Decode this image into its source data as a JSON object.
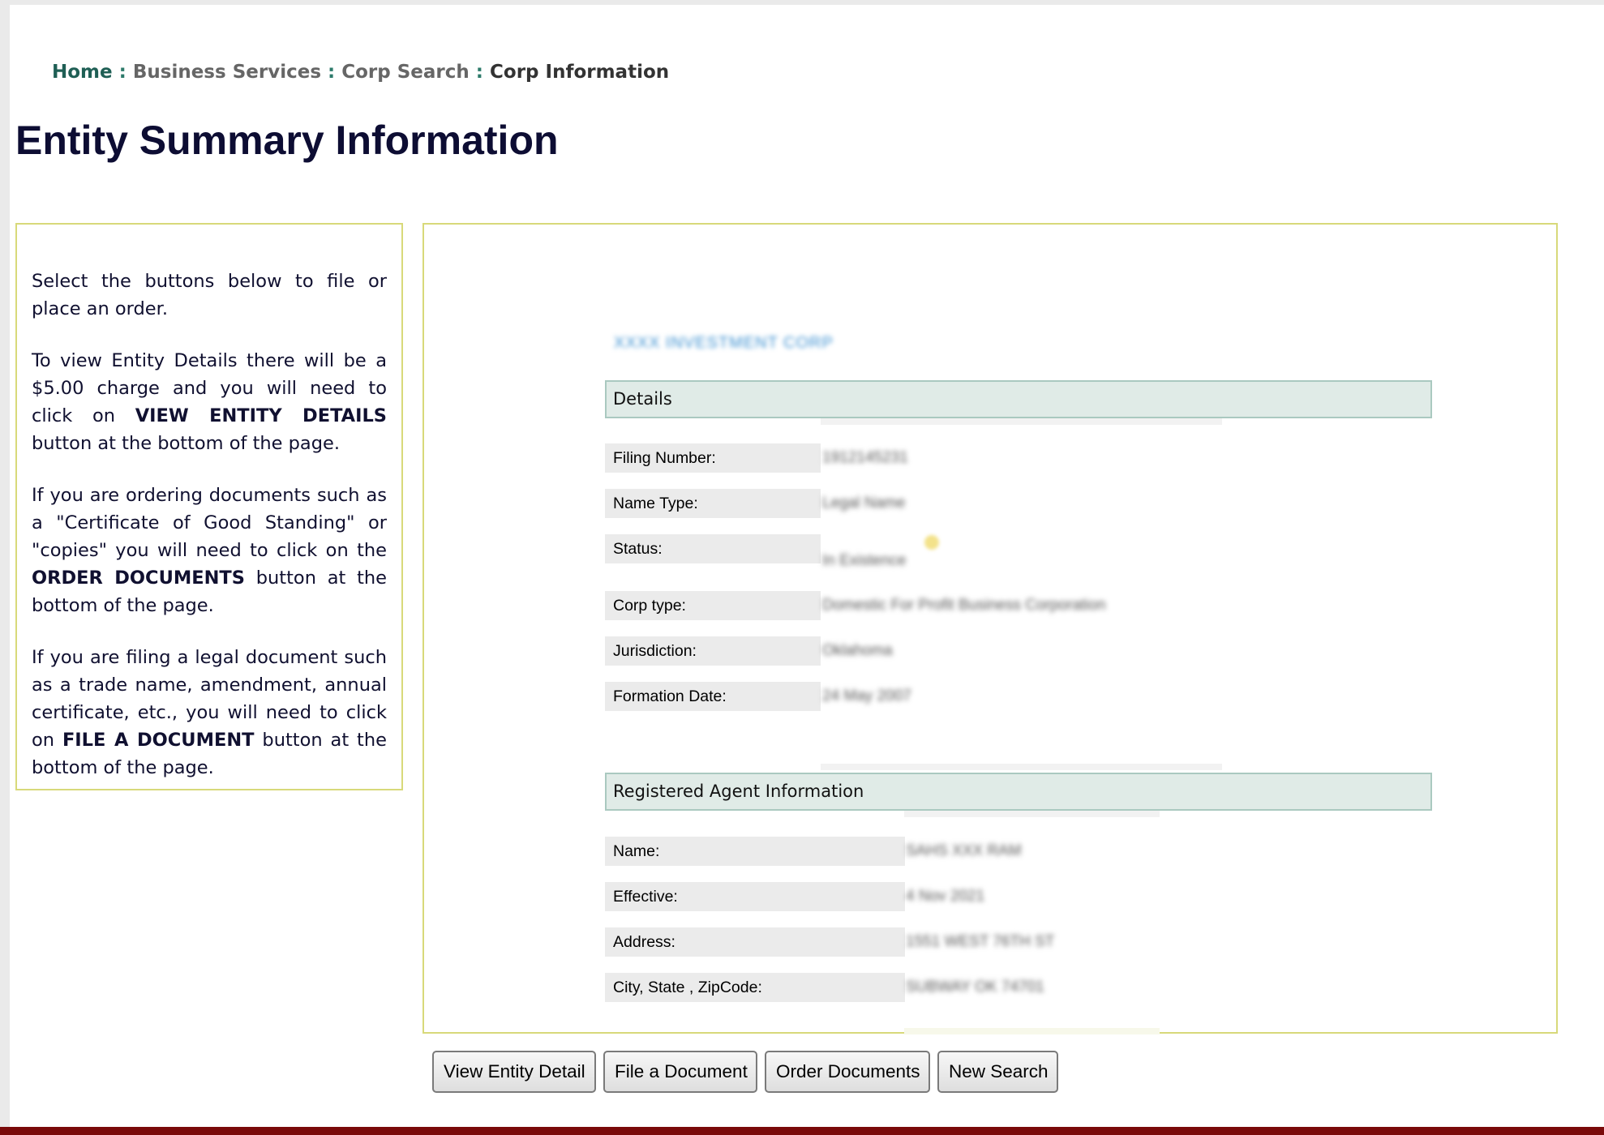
{
  "breadcrumb": {
    "home": "Home",
    "sep": ":",
    "business_services": "Business Services",
    "corp_search": "Corp Search",
    "current": "Corp Information"
  },
  "page_title": "Entity Summary Information",
  "info_box": {
    "p1": "Select the buttons below to file or place an order.",
    "p2_pre": "To view Entity Details there will be a $5.00 charge and you will need to click on ",
    "p2_bold": "VIEW ENTITY DETAILS",
    "p2_post": " button at the bottom of the page.",
    "p3_pre": "If you are ordering documents such as a \"Certificate of Good Standing\" or \"copies\" you will need to click on the ",
    "p3_bold": "ORDER DOCUMENTS",
    "p3_post": " button at the bottom of the page.",
    "p4_pre": "If you are filing a legal document such as a trade name, amendment, annual certificate, etc., you will need to click on ",
    "p4_bold": "FILE A DOCUMENT",
    "p4_post": " button at the bottom of the page."
  },
  "entity_name": "XXXX INVESTMENT CORP",
  "details": {
    "header": "Details",
    "filing_number_label": "Filing Number:",
    "filing_number": "1912145231",
    "name_type_label": "Name Type:",
    "name_type": "Legal Name",
    "status_label": "Status:",
    "status": "In Existence",
    "corp_type_label": "Corp type:",
    "corp_type": "Domestic For Profit Business Corporation",
    "jurisdiction_label": "Jurisdiction:",
    "jurisdiction": "Oklahoma",
    "formation_date_label": "Formation Date:",
    "formation_date": "24 May 2007"
  },
  "agent": {
    "header": "Registered Agent Information",
    "name_label": "Name:",
    "name": "SAHS XXX RAM",
    "effective_label": "Effective:",
    "effective": "4 Nov 2021",
    "address_label": "Address:",
    "address": "1551 WEST 76TH ST",
    "city_label": "City, State , ZipCode:",
    "city": "SUBWAY OK 74701"
  },
  "buttons": {
    "view_entity_detail": "View Entity Detail",
    "file_document": "File a Document",
    "order_documents": "Order Documents",
    "new_search": "New Search"
  },
  "colors": {
    "accent_green": "#1f5f55",
    "box_border": "#d8d97a",
    "section_bg": "#e0ebe7",
    "footer": "#7a0a0a"
  }
}
